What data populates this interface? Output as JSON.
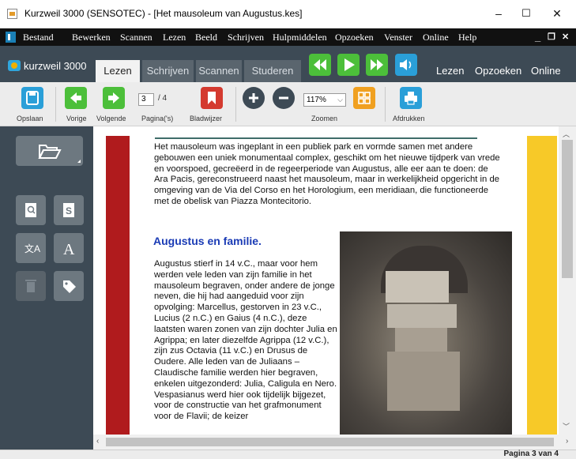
{
  "window": {
    "title": "Kurzweil 3000 (SENSOTEC) - [Het mausoleum van Augustus.kes]",
    "minimize": "–",
    "maximize": "☐",
    "close": "✕"
  },
  "menu": {
    "items": [
      "Bestand",
      "Bewerken",
      "Scannen",
      "Lezen",
      "Beeld",
      "Schrijven",
      "Hulpmiddelen",
      "Opzoeken",
      "Venster",
      "Online",
      "Help"
    ],
    "minimize": "_",
    "restore": "❐",
    "close": "✕"
  },
  "tabs": {
    "brand": "kurzweil 3000",
    "items": [
      "Lezen",
      "Schrijven",
      "Scannen",
      "Studeren"
    ],
    "active": "Lezen",
    "right_nav": [
      "Lezen",
      "Opzoeken",
      "Online"
    ]
  },
  "toolbar": {
    "save": "Opslaan",
    "prev": "Vorige",
    "next": "Volgende",
    "page_label": "Pagina('s)",
    "page_value": "3",
    "page_total": "/ 4",
    "bookmark": "Bladwijzer",
    "zoom_label": "Zoomen",
    "zoom_value": "117%",
    "print": "Afdrukken"
  },
  "document": {
    "paragraph1": "Het mausoleum was ingeplant in een publiek park en vormde samen met andere gebouwen een uniek monumentaal complex, geschikt om het nieuwe tijdperk van vrede en voorspoed, gecreëerd in de regeerperiode van Augustus, alle eer aan te doen: de Ara Pacis, gereconstrueerd naast het mausoleum, maar in werkelijkheid opgericht in de omgeving van de Via del Corso en het Horologium, een meridiaan, die functioneerde met de obelisk van Piazza Montecitorio.",
    "heading": "Augustus en familie.",
    "paragraph2": "Augustus stierf in 14 v.C., maar voor hem werden vele leden van zijn familie in het mausoleum begraven, onder andere de jonge neven, die hij had aangeduid voor zijn opvolging: Marcellus, gestorven in 23 v.C., Lucius (2 n.C.) en Gaius (4 n.C.), deze laatsten waren zonen van zijn dochter Julia en Agrippa; en later diezelfde Agrippa (12 v.C.), zijn zus Octavia (11 v.C.) en Drusus de Oudere. Alle leden van de Juliaans – Claudische familie werden hier begraven, enkelen uitgezonderd: Julia, Caligula en Nero. Vespasianus werd hier ook tijdelijk bijgezet, voor de constructie van het grafmonument voor de Flavii; de keizer"
  },
  "status": {
    "page": "Pagina 3 van 4"
  },
  "colors": {
    "dark_panel": "#3d4a55",
    "green": "#4cbf3a",
    "blue": "#2a9fd8",
    "red": "#d43a2f",
    "orange": "#f0a020",
    "heading": "#1a3bb5"
  }
}
